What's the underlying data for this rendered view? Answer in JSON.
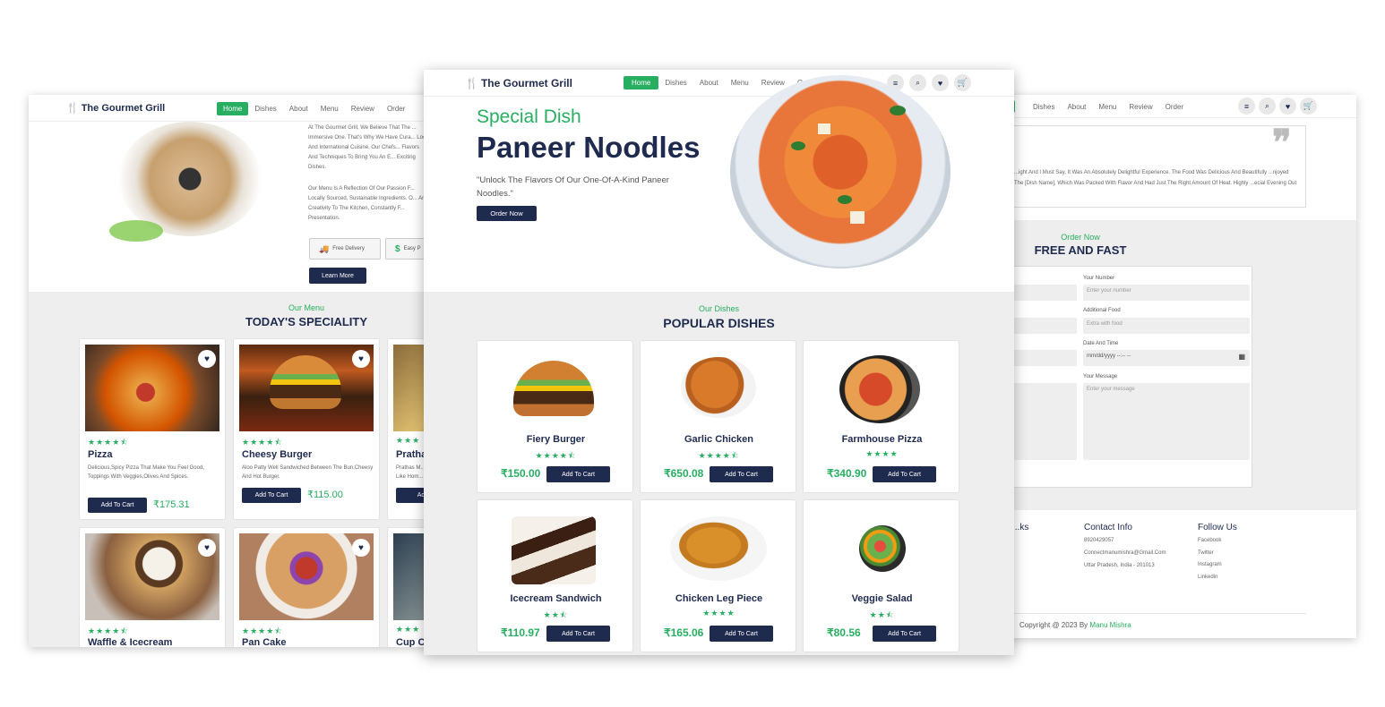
{
  "brand": "The Gourmet Grill",
  "nav": {
    "home": "Home",
    "dishes": "Dishes",
    "about": "About",
    "menu": "Menu",
    "review": "Review",
    "order": "Order"
  },
  "left": {
    "about_p1": "At The Gourmet Grill, We Believe That The ... Immersive One. That's Why We Have Cura... Local And International Cuisine. Our Chefs... Flavors And Techniques To Bring You An E... Exciting Dishes.",
    "about_p2": "Our Menu Is A Reflection Of Our Passion F... Locally Sourced, Sustainable Ingredients. O... And Creativity To The Kitchen, Constantly F... Presentation.",
    "free_delivery": "Free Delivery",
    "easy_pay": "Easy P",
    "learn_more": "Learn More",
    "sub": "Our Menu",
    "title": "TODAY'S SPECIALITY",
    "cards": [
      {
        "name": "Pizza",
        "desc": "Delicious,Spicy Pizza That Make You Feel Good, Toppings With Veggies,Olives And Spices.",
        "price": "₹175.31",
        "btn": "Add To Cart",
        "stars": "★★★★⯪"
      },
      {
        "name": "Cheesy Burger",
        "desc": "Aloo Patty Well Sandwiched Between The Bun,Cheesy And Hot Burger.",
        "price": "₹115.00",
        "btn": "Add To Cart",
        "stars": "★★★★⯪"
      },
      {
        "name": "Pratha",
        "desc": "Prathas M... Like Hom...",
        "btn": "Add T",
        "stars": "★★★"
      },
      {
        "name": "Waffle & Icecream",
        "stars": "★★★★⯪"
      },
      {
        "name": "Pan Cake",
        "stars": "★★★★⯪"
      },
      {
        "name": "Cup C",
        "stars": "★★★"
      }
    ]
  },
  "center": {
    "special": "Special Dish",
    "dish": "Paneer Noodles",
    "tagline": "\"Unlock The Flavors Of Our One-Of-A-Kind Paneer Noodles.\"",
    "order_now": "Order Now",
    "sub": "Our Dishes",
    "title": "POPULAR DISHES",
    "dishes": [
      {
        "name": "Fiery Burger",
        "price": "₹150.00",
        "stars": "★★★★⯪",
        "btn": "Add To Cart"
      },
      {
        "name": "Garlic Chicken",
        "price": "₹650.08",
        "stars": "★★★★⯪",
        "btn": "Add To Cart"
      },
      {
        "name": "Farmhouse Pizza",
        "price": "₹340.90",
        "stars": "★★★★",
        "btn": "Add To Cart"
      },
      {
        "name": "Icecream Sandwich",
        "price": "₹110.97",
        "stars": "★★⯪",
        "btn": "Add To Cart"
      },
      {
        "name": "Chicken Leg Piece",
        "price": "₹165.06",
        "stars": "★★★★",
        "btn": "Add To Cart"
      },
      {
        "name": "Veggie Salad",
        "price": "₹80.56",
        "stars": "★★⯪",
        "btn": "Add To Cart"
      }
    ]
  },
  "right": {
    "review": "...ight And I Must Say, It Was An Absolutely Delightful Experience. The Food Was Delicious And Beautifully ...njoyed The [Dish Name], Which Was Packed With Flavor And Had Just The Right Amount Of Heat. Highly ...ecial Evening Out",
    "sub": "Order Now",
    "title": "FREE AND FAST",
    "your_number": "Your Number",
    "number_ph": "Enter your number",
    "additional_food": "Additional Food",
    "food_ph": "Extra with food",
    "date_time": "Date And Time",
    "date_ph": "mm/dd/yyyy --:-- --",
    "your_message": "Your Message",
    "message_ph": "Enter your message",
    "links_title": "...ks",
    "contact_title": "Contact Info",
    "phone": "8920429057",
    "email": "Connectmanumishra@Gmail.Com",
    "address": "Uttar Pradesh, India - 201013",
    "follow_title": "Follow Us",
    "social": [
      "Facebook",
      "Twitter",
      "Instagram",
      "Linkedin"
    ],
    "copyright": "Copyright @ 2023 By",
    "author": "Manu Mishra"
  },
  "colors": {
    "accent": "#27ae60",
    "navy": "#1f2a4f",
    "grey": "#eeeeee"
  }
}
